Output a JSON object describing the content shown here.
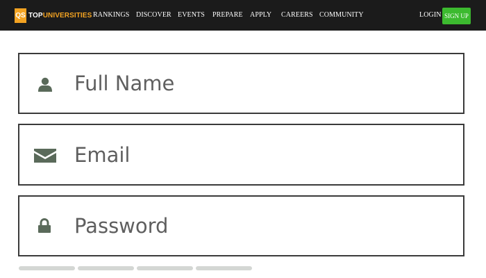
{
  "header": {
    "logo": {
      "mark": "QS",
      "text_top": "TOP",
      "text_uni": "UNIVERSITIES",
      "mark_color": "#f3a322"
    },
    "nav": [
      {
        "label": "RANKINGS"
      },
      {
        "label": "DISCOVER"
      },
      {
        "label": "EVENTS"
      },
      {
        "label": "PREPARE"
      },
      {
        "label": "APPLY"
      },
      {
        "label": "CAREERS"
      },
      {
        "label": "COMMUNITY"
      }
    ],
    "login_label": "LOGIN",
    "signup_label": "SIGN UP",
    "signup_color": "#3cba2f"
  },
  "form": {
    "full_name": {
      "placeholder": "Full Name",
      "icon": "user-icon"
    },
    "email": {
      "placeholder": "Email",
      "icon": "envelope-icon"
    },
    "password": {
      "placeholder": "Password",
      "icon": "lock-icon"
    }
  },
  "icon_color": "#5a6a5a"
}
